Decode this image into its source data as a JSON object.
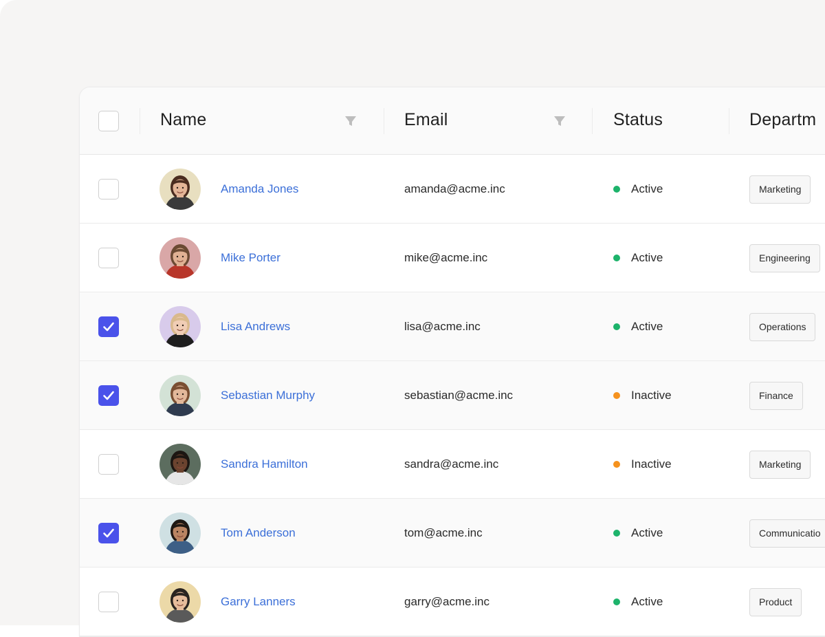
{
  "table": {
    "columns": {
      "name": "Name",
      "email": "Email",
      "status": "Status",
      "department": "Departm"
    },
    "select_all_checked": false,
    "rows": [
      {
        "name": "Amanda Jones",
        "email": "amanda@acme.inc",
        "status": "Active",
        "status_color": "#1db36b",
        "department": "Marketing",
        "checked": false,
        "avatar_bg": "#e8dfc0",
        "skin": "#e3b597",
        "hair": "#4a2c1f",
        "shirt": "#3a3a3a"
      },
      {
        "name": "Mike Porter",
        "email": "mike@acme.inc",
        "status": "Active",
        "status_color": "#1db36b",
        "department": "Engineering",
        "checked": false,
        "avatar_bg": "#d9a7a7",
        "skin": "#e0b193",
        "hair": "#6b4a33",
        "shirt": "#b8362a"
      },
      {
        "name": "Lisa Andrews",
        "email": "lisa@acme.inc",
        "status": "Active",
        "status_color": "#1db36b",
        "department": "Operations",
        "checked": true,
        "avatar_bg": "#d8cbeb",
        "skin": "#f0cdb5",
        "hair": "#d9b98c",
        "shirt": "#1e1e1e"
      },
      {
        "name": "Sebastian Murphy",
        "email": "sebastian@acme.inc",
        "status": "Inactive",
        "status_color": "#f5921e",
        "department": "Finance",
        "checked": true,
        "avatar_bg": "#d3e2d6",
        "skin": "#e2b89a",
        "hair": "#7a4f32",
        "shirt": "#2f3b4f"
      },
      {
        "name": "Sandra Hamilton",
        "email": "sandra@acme.inc",
        "status": "Inactive",
        "status_color": "#f5921e",
        "department": "Marketing",
        "checked": false,
        "avatar_bg": "#5c6d5f",
        "skin": "#6b432f",
        "hair": "#1c1612",
        "shirt": "#e6e6e6"
      },
      {
        "name": "Tom Anderson",
        "email": "tom@acme.inc",
        "status": "Active",
        "status_color": "#1db36b",
        "department": "Communicatio",
        "checked": true,
        "avatar_bg": "#cfe0e3",
        "skin": "#b98462",
        "hair": "#1e1712",
        "shirt": "#3d5f86"
      },
      {
        "name": "Garry Lanners",
        "email": "garry@acme.inc",
        "status": "Active",
        "status_color": "#1db36b",
        "department": "Product",
        "checked": false,
        "avatar_bg": "#ecd9a8",
        "skin": "#e6bc9b",
        "hair": "#2a2420",
        "shirt": "#5a5a5a"
      }
    ]
  },
  "icons": {
    "filter": "filter-icon",
    "check": "check-icon"
  },
  "colors": {
    "accent": "#4a52ea",
    "link": "#3b6fd8",
    "active": "#1db36b",
    "inactive": "#f5921e"
  }
}
